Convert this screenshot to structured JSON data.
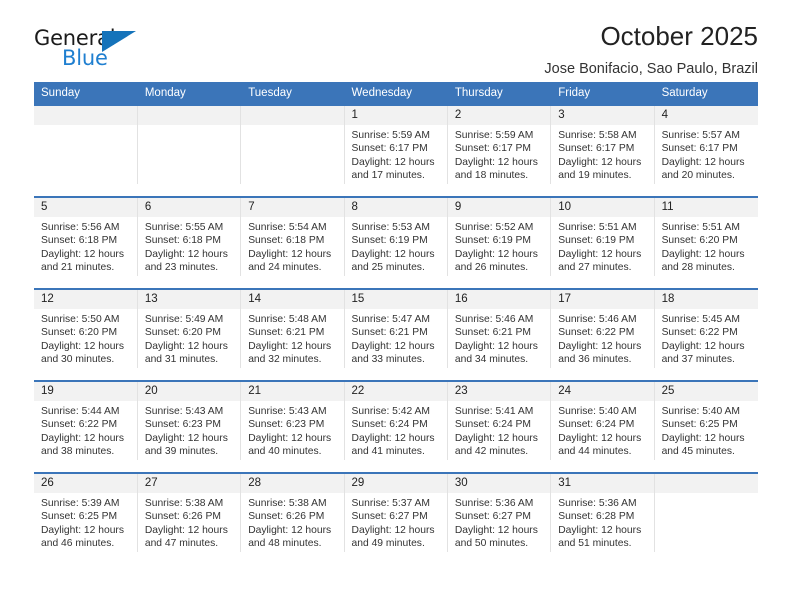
{
  "brand": {
    "name_top": "General",
    "name_bottom": "Blue",
    "triangle_color": "#1573ba",
    "blue_text_color": "#1f7fd0"
  },
  "header": {
    "title": "October 2025",
    "subtitle": "Jose Bonifacio, Sao Paulo, Brazil",
    "accent_color": "#3b75b9"
  },
  "calendar": {
    "weekday_headers": [
      "Sunday",
      "Monday",
      "Tuesday",
      "Wednesday",
      "Thursday",
      "Friday",
      "Saturday"
    ],
    "labels": {
      "sunrise": "Sunrise:",
      "sunset": "Sunset:",
      "daylight": "Daylight:"
    },
    "weeks": [
      [
        {
          "day": "",
          "sunrise": "",
          "sunset": "",
          "daylight_line1": "",
          "daylight_line2": ""
        },
        {
          "day": "",
          "sunrise": "",
          "sunset": "",
          "daylight_line1": "",
          "daylight_line2": ""
        },
        {
          "day": "",
          "sunrise": "",
          "sunset": "",
          "daylight_line1": "",
          "daylight_line2": ""
        },
        {
          "day": "1",
          "sunrise": "Sunrise: 5:59 AM",
          "sunset": "Sunset: 6:17 PM",
          "daylight_line1": "Daylight: 12 hours",
          "daylight_line2": "and 17 minutes."
        },
        {
          "day": "2",
          "sunrise": "Sunrise: 5:59 AM",
          "sunset": "Sunset: 6:17 PM",
          "daylight_line1": "Daylight: 12 hours",
          "daylight_line2": "and 18 minutes."
        },
        {
          "day": "3",
          "sunrise": "Sunrise: 5:58 AM",
          "sunset": "Sunset: 6:17 PM",
          "daylight_line1": "Daylight: 12 hours",
          "daylight_line2": "and 19 minutes."
        },
        {
          "day": "4",
          "sunrise": "Sunrise: 5:57 AM",
          "sunset": "Sunset: 6:17 PM",
          "daylight_line1": "Daylight: 12 hours",
          "daylight_line2": "and 20 minutes."
        }
      ],
      [
        {
          "day": "5",
          "sunrise": "Sunrise: 5:56 AM",
          "sunset": "Sunset: 6:18 PM",
          "daylight_line1": "Daylight: 12 hours",
          "daylight_line2": "and 21 minutes."
        },
        {
          "day": "6",
          "sunrise": "Sunrise: 5:55 AM",
          "sunset": "Sunset: 6:18 PM",
          "daylight_line1": "Daylight: 12 hours",
          "daylight_line2": "and 23 minutes."
        },
        {
          "day": "7",
          "sunrise": "Sunrise: 5:54 AM",
          "sunset": "Sunset: 6:18 PM",
          "daylight_line1": "Daylight: 12 hours",
          "daylight_line2": "and 24 minutes."
        },
        {
          "day": "8",
          "sunrise": "Sunrise: 5:53 AM",
          "sunset": "Sunset: 6:19 PM",
          "daylight_line1": "Daylight: 12 hours",
          "daylight_line2": "and 25 minutes."
        },
        {
          "day": "9",
          "sunrise": "Sunrise: 5:52 AM",
          "sunset": "Sunset: 6:19 PM",
          "daylight_line1": "Daylight: 12 hours",
          "daylight_line2": "and 26 minutes."
        },
        {
          "day": "10",
          "sunrise": "Sunrise: 5:51 AM",
          "sunset": "Sunset: 6:19 PM",
          "daylight_line1": "Daylight: 12 hours",
          "daylight_line2": "and 27 minutes."
        },
        {
          "day": "11",
          "sunrise": "Sunrise: 5:51 AM",
          "sunset": "Sunset: 6:20 PM",
          "daylight_line1": "Daylight: 12 hours",
          "daylight_line2": "and 28 minutes."
        }
      ],
      [
        {
          "day": "12",
          "sunrise": "Sunrise: 5:50 AM",
          "sunset": "Sunset: 6:20 PM",
          "daylight_line1": "Daylight: 12 hours",
          "daylight_line2": "and 30 minutes."
        },
        {
          "day": "13",
          "sunrise": "Sunrise: 5:49 AM",
          "sunset": "Sunset: 6:20 PM",
          "daylight_line1": "Daylight: 12 hours",
          "daylight_line2": "and 31 minutes."
        },
        {
          "day": "14",
          "sunrise": "Sunrise: 5:48 AM",
          "sunset": "Sunset: 6:21 PM",
          "daylight_line1": "Daylight: 12 hours",
          "daylight_line2": "and 32 minutes."
        },
        {
          "day": "15",
          "sunrise": "Sunrise: 5:47 AM",
          "sunset": "Sunset: 6:21 PM",
          "daylight_line1": "Daylight: 12 hours",
          "daylight_line2": "and 33 minutes."
        },
        {
          "day": "16",
          "sunrise": "Sunrise: 5:46 AM",
          "sunset": "Sunset: 6:21 PM",
          "daylight_line1": "Daylight: 12 hours",
          "daylight_line2": "and 34 minutes."
        },
        {
          "day": "17",
          "sunrise": "Sunrise: 5:46 AM",
          "sunset": "Sunset: 6:22 PM",
          "daylight_line1": "Daylight: 12 hours",
          "daylight_line2": "and 36 minutes."
        },
        {
          "day": "18",
          "sunrise": "Sunrise: 5:45 AM",
          "sunset": "Sunset: 6:22 PM",
          "daylight_line1": "Daylight: 12 hours",
          "daylight_line2": "and 37 minutes."
        }
      ],
      [
        {
          "day": "19",
          "sunrise": "Sunrise: 5:44 AM",
          "sunset": "Sunset: 6:22 PM",
          "daylight_line1": "Daylight: 12 hours",
          "daylight_line2": "and 38 minutes."
        },
        {
          "day": "20",
          "sunrise": "Sunrise: 5:43 AM",
          "sunset": "Sunset: 6:23 PM",
          "daylight_line1": "Daylight: 12 hours",
          "daylight_line2": "and 39 minutes."
        },
        {
          "day": "21",
          "sunrise": "Sunrise: 5:43 AM",
          "sunset": "Sunset: 6:23 PM",
          "daylight_line1": "Daylight: 12 hours",
          "daylight_line2": "and 40 minutes."
        },
        {
          "day": "22",
          "sunrise": "Sunrise: 5:42 AM",
          "sunset": "Sunset: 6:24 PM",
          "daylight_line1": "Daylight: 12 hours",
          "daylight_line2": "and 41 minutes."
        },
        {
          "day": "23",
          "sunrise": "Sunrise: 5:41 AM",
          "sunset": "Sunset: 6:24 PM",
          "daylight_line1": "Daylight: 12 hours",
          "daylight_line2": "and 42 minutes."
        },
        {
          "day": "24",
          "sunrise": "Sunrise: 5:40 AM",
          "sunset": "Sunset: 6:24 PM",
          "daylight_line1": "Daylight: 12 hours",
          "daylight_line2": "and 44 minutes."
        },
        {
          "day": "25",
          "sunrise": "Sunrise: 5:40 AM",
          "sunset": "Sunset: 6:25 PM",
          "daylight_line1": "Daylight: 12 hours",
          "daylight_line2": "and 45 minutes."
        }
      ],
      [
        {
          "day": "26",
          "sunrise": "Sunrise: 5:39 AM",
          "sunset": "Sunset: 6:25 PM",
          "daylight_line1": "Daylight: 12 hours",
          "daylight_line2": "and 46 minutes."
        },
        {
          "day": "27",
          "sunrise": "Sunrise: 5:38 AM",
          "sunset": "Sunset: 6:26 PM",
          "daylight_line1": "Daylight: 12 hours",
          "daylight_line2": "and 47 minutes."
        },
        {
          "day": "28",
          "sunrise": "Sunrise: 5:38 AM",
          "sunset": "Sunset: 6:26 PM",
          "daylight_line1": "Daylight: 12 hours",
          "daylight_line2": "and 48 minutes."
        },
        {
          "day": "29",
          "sunrise": "Sunrise: 5:37 AM",
          "sunset": "Sunset: 6:27 PM",
          "daylight_line1": "Daylight: 12 hours",
          "daylight_line2": "and 49 minutes."
        },
        {
          "day": "30",
          "sunrise": "Sunrise: 5:36 AM",
          "sunset": "Sunset: 6:27 PM",
          "daylight_line1": "Daylight: 12 hours",
          "daylight_line2": "and 50 minutes."
        },
        {
          "day": "31",
          "sunrise": "Sunrise: 5:36 AM",
          "sunset": "Sunset: 6:28 PM",
          "daylight_line1": "Daylight: 12 hours",
          "daylight_line2": "and 51 minutes."
        },
        {
          "day": "",
          "sunrise": "",
          "sunset": "",
          "daylight_line1": "",
          "daylight_line2": ""
        }
      ]
    ]
  }
}
